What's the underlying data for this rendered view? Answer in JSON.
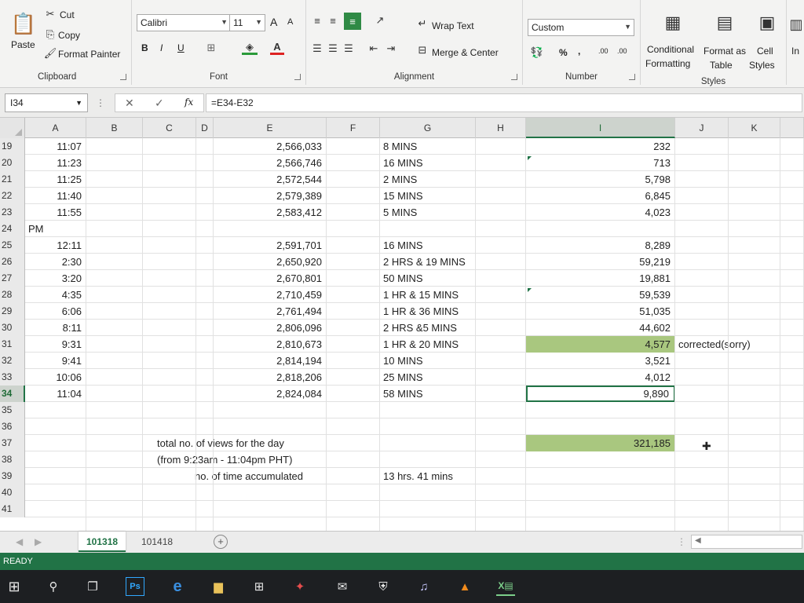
{
  "ribbon": {
    "clipboard": {
      "cut": "Cut",
      "copy": "Copy",
      "format_painter": "Format Painter",
      "paste": "Paste",
      "label": "Clipboard"
    },
    "font": {
      "name": "Calibri",
      "size": "11",
      "label": "Font",
      "bold": "B",
      "italic": "I",
      "underline": "U"
    },
    "alignment": {
      "wrap_text": "Wrap Text",
      "merge_center": "Merge & Center",
      "label": "Alignment"
    },
    "number": {
      "format": "Custom",
      "percent": "%",
      "comma": ",",
      "inc_dec": ".00",
      "label": "Number"
    },
    "styles": {
      "conditional": "Conditional",
      "conditional2": "Formatting",
      "format_as": "Format as",
      "format_as2": "Table",
      "cell": "Cell",
      "cell2": "Styles",
      "label": "Styles",
      "insert_partial": "In"
    }
  },
  "formula_bar": {
    "name_box": "I34",
    "fx": "fx",
    "formula": "=E34-E32"
  },
  "columns": [
    "A",
    "B",
    "C",
    "D",
    "E",
    "F",
    "G",
    "H",
    "I",
    "J",
    "K"
  ],
  "selected_column": "I",
  "rows": [
    {
      "n": "19",
      "a": "11:07",
      "e": "2,566,033",
      "g": "8 MINS",
      "i": "232"
    },
    {
      "n": "20",
      "a": "11:23",
      "e": "2,566,746",
      "g": "16 MINS",
      "i": "713"
    },
    {
      "n": "21",
      "a": "11:25",
      "e": "2,572,544",
      "g": "2 MINS",
      "i": "5,798"
    },
    {
      "n": "22",
      "a": "11:40",
      "e": "2,579,389",
      "g": "15 MINS",
      "i": "6,845"
    },
    {
      "n": "23",
      "a": "11:55",
      "e": "2,583,412",
      "g": "5 MINS",
      "i": "4,023"
    },
    {
      "n": "24",
      "pm": "PM"
    },
    {
      "n": "25",
      "a": "12:11",
      "e": "2,591,701",
      "g": "16 MINS",
      "i": "8,289"
    },
    {
      "n": "26",
      "a": "2:30",
      "e": "2,650,920",
      "g": "2 HRS & 19 MINS",
      "i": "59,219"
    },
    {
      "n": "27",
      "a": "3:20",
      "e": "2,670,801",
      "g": "50 MINS",
      "i": "19,881"
    },
    {
      "n": "28",
      "a": "4:35",
      "e": "2,710,459",
      "g": "1 HR & 15 MINS",
      "i": "59,539"
    },
    {
      "n": "29",
      "a": "6:06",
      "e": "2,761,494",
      "g": "1 HR & 36 MINS",
      "i": "51,035"
    },
    {
      "n": "30",
      "a": "8:11",
      "e": "2,806,096",
      "g": "2 HRS &5 MINS",
      "i": "44,602"
    },
    {
      "n": "31",
      "a": "9:31",
      "e": "2,810,673",
      "g": "1 HR & 20 MINS",
      "i": "4,577",
      "j": "corrected(sorry)"
    },
    {
      "n": "32",
      "a": "9:41",
      "e": "2,814,194",
      "g": "10 MINS",
      "i": "3,521"
    },
    {
      "n": "33",
      "a": "10:06",
      "e": "2,818,206",
      "g": "25 MINS",
      "i": "4,012"
    },
    {
      "n": "34",
      "a": "11:04",
      "e": "2,824,084",
      "g": "58 MINS",
      "i": "9,890"
    },
    {
      "n": "35"
    },
    {
      "n": "36"
    },
    {
      "n": "37",
      "c_note": "total no. of views for the day",
      "i": "321,185"
    },
    {
      "n": "38",
      "c_note": "(from 9:23am - 11:04pm PHT)"
    },
    {
      "n": "39",
      "c_note": "no. of time accumulated",
      "g": "13 hrs. 41 mins"
    },
    {
      "n": "40"
    },
    {
      "n": "41"
    }
  ],
  "sheets": {
    "tab1": "101318",
    "tab2": "101418",
    "add": "+"
  },
  "status": {
    "ready": "READY"
  },
  "colors": {
    "excel_green": "#217346",
    "highlight": "#a9c77f"
  }
}
